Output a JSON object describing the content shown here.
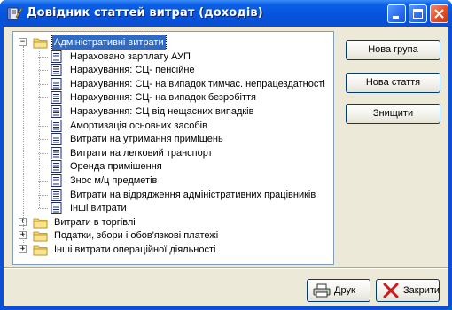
{
  "window": {
    "title": "Довідник статтей витрат (доходів)",
    "icons": {
      "app": "book-pencil-icon",
      "minimize": "minimize-icon",
      "maximize": "maximize-icon",
      "close": "close-icon"
    }
  },
  "tree": {
    "groups": [
      {
        "label": "Адміністративні витрати",
        "expanded": true,
        "selected": true,
        "expander": "−",
        "items": [
          "Нараховано зарплату АУП",
          "Нарахування: СЦ- пенсійне",
          "Нарахування: СЦ- на випадок тимчас. непрацездатності",
          "Нарахування: СЦ- на випадок безробіття",
          "Нарахування: СЦ  від нещасних випадків",
          "Амортизація основних засобів",
          "Витрати на утримання приміщень",
          "Витрати на легковий транспорт",
          "Оренда примішення",
          "Знос м/ц предметів",
          "Витрати на відрядження адміністративних працівників",
          "Інші витрати"
        ]
      },
      {
        "label": "Витрати в торгівлі",
        "expanded": false,
        "expander": "+"
      },
      {
        "label": "Податки, збори і обов'язкові платежі",
        "expanded": false,
        "expander": "+"
      },
      {
        "label": "Інші витрати операційної діяльності",
        "expanded": false,
        "expander": "+"
      }
    ]
  },
  "buttons": {
    "new_group": "Нова група",
    "new_item": "Нова стаття",
    "delete": "Знищити",
    "print": "Друк",
    "close": "Закрити"
  },
  "colors": {
    "title_bar": "#0553dd",
    "selection": "#316ac5",
    "face": "#ece9d8",
    "folder": "#f5d86b",
    "close_x": "#cc1b1b"
  }
}
